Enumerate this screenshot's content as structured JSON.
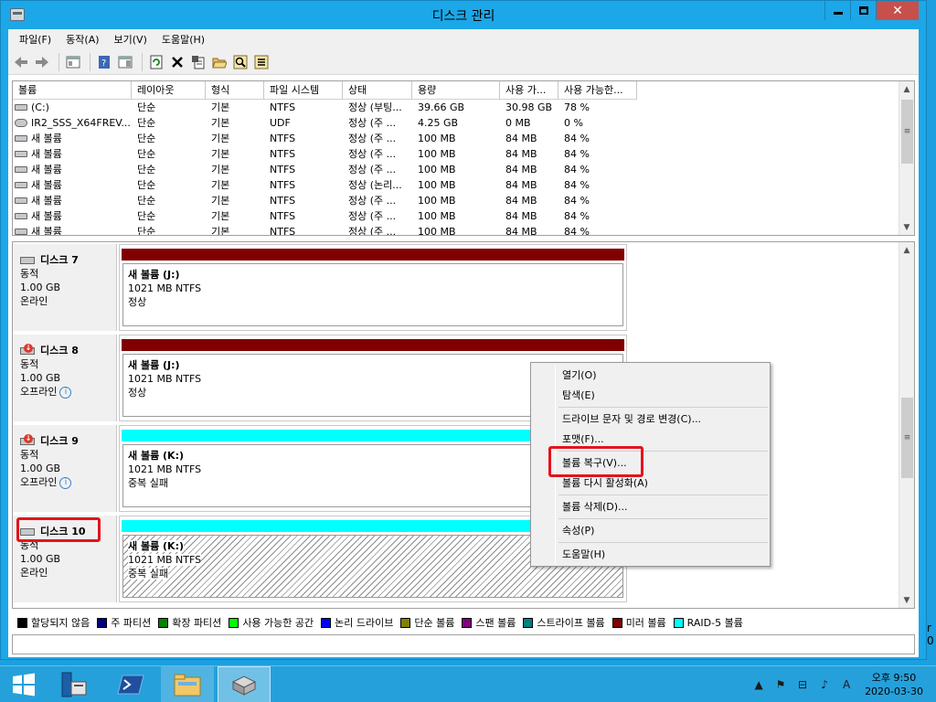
{
  "window": {
    "title": "디스크 관리",
    "close_label": "✕"
  },
  "menu": {
    "file": "파일(F)",
    "action": "동작(A)",
    "view": "보기(V)",
    "help": "도움말(H)"
  },
  "volume_list": {
    "columns": [
      "볼륨",
      "레이아웃",
      "형식",
      "파일 시스템",
      "상태",
      "용량",
      "사용 가...",
      "사용 가능한..."
    ],
    "rows": [
      [
        "(C:)",
        "단순",
        "기본",
        "NTFS",
        "정상 (부팅...",
        "39.66 GB",
        "30.98 GB",
        "78 %"
      ],
      [
        "IR2_SSS_X64FREV...",
        "단순",
        "기본",
        "UDF",
        "정상 (주 ...",
        "4.25 GB",
        "0 MB",
        "0 %"
      ],
      [
        "새 볼륨",
        "단순",
        "기본",
        "NTFS",
        "정상 (주 ...",
        "100 MB",
        "84 MB",
        "84 %"
      ],
      [
        "새 볼륨",
        "단순",
        "기본",
        "NTFS",
        "정상 (주 ...",
        "100 MB",
        "84 MB",
        "84 %"
      ],
      [
        "새 볼륨",
        "단순",
        "기본",
        "NTFS",
        "정상 (주 ...",
        "100 MB",
        "84 MB",
        "84 %"
      ],
      [
        "새 볼륨",
        "단순",
        "기본",
        "NTFS",
        "정상 (논리...",
        "100 MB",
        "84 MB",
        "84 %"
      ],
      [
        "새 볼륨",
        "단순",
        "기본",
        "NTFS",
        "정상 (주 ...",
        "100 MB",
        "84 MB",
        "84 %"
      ],
      [
        "새 볼륨",
        "단순",
        "기본",
        "NTFS",
        "정상 (주 ...",
        "100 MB",
        "84 MB",
        "84 %"
      ],
      [
        "새 볼륨",
        "단순",
        "기본",
        "NTFS",
        "정상 (주 ...",
        "100 MB",
        "84 MB",
        "84 %"
      ]
    ]
  },
  "disks": [
    {
      "name": "디스크 7",
      "type": "동적",
      "size": "1.00 GB",
      "state": "온라인",
      "volume": {
        "title": "새 볼륨  (J:)",
        "size": "1021 MB NTFS",
        "status": "정상"
      },
      "bar_color": "#800000"
    },
    {
      "name": "디스크 8",
      "type": "동적",
      "size": "1.00 GB",
      "state": "오프라인",
      "volume": {
        "title": "새 볼륨  (J:)",
        "size": "1021 MB NTFS",
        "status": "정상"
      },
      "bar_color": "#800000"
    },
    {
      "name": "디스크 9",
      "type": "동적",
      "size": "1.00 GB",
      "state": "오프라인",
      "volume": {
        "title": "새 볼륨  (K:)",
        "size": "1021 MB NTFS",
        "status": "중복 실패"
      },
      "bar_color": "#00ffff"
    },
    {
      "name": "디스크 10",
      "type": "동적",
      "size": "1.00 GB",
      "state": "온라인",
      "volume": {
        "title": "새 볼륨  (K:)",
        "size": "1021 MB NTFS",
        "status": "중복 실패"
      },
      "bar_color": "#00ffff"
    }
  ],
  "context_menu": {
    "open": "열기(O)",
    "explore": "탐색(E)",
    "change_letter": "드라이브 문자 및 경로 변경(C)...",
    "format": "포맷(F)...",
    "reactivate": "볼륨 복구(V)...",
    "reactivate_volume": "볼륨 다시 활성화(A)",
    "delete": "볼륨 삭제(D)...",
    "properties": "속성(P)",
    "help": "도움말(H)"
  },
  "legend": [
    {
      "label": "할당되지 않음",
      "color": "#000000"
    },
    {
      "label": "주 파티션",
      "color": "#000080"
    },
    {
      "label": "확장 파티션",
      "color": "#008000"
    },
    {
      "label": "사용 가능한 공간",
      "color": "#00ff00"
    },
    {
      "label": "논리 드라이브",
      "color": "#0000ff"
    },
    {
      "label": "단순 볼륨",
      "color": "#808000"
    },
    {
      "label": "스팬 볼륨",
      "color": "#800080"
    },
    {
      "label": "스트라이프 볼륨",
      "color": "#008080"
    },
    {
      "label": "미러 볼륨",
      "color": "#800000"
    },
    {
      "label": "RAID-5 볼륨",
      "color": "#00ffff"
    }
  ],
  "clock": {
    "time": "오후 9:50",
    "date": "2020-03-30"
  },
  "tray": {
    "ime": "A"
  },
  "edge_text": {
    "a": "r",
    "b": "0"
  }
}
